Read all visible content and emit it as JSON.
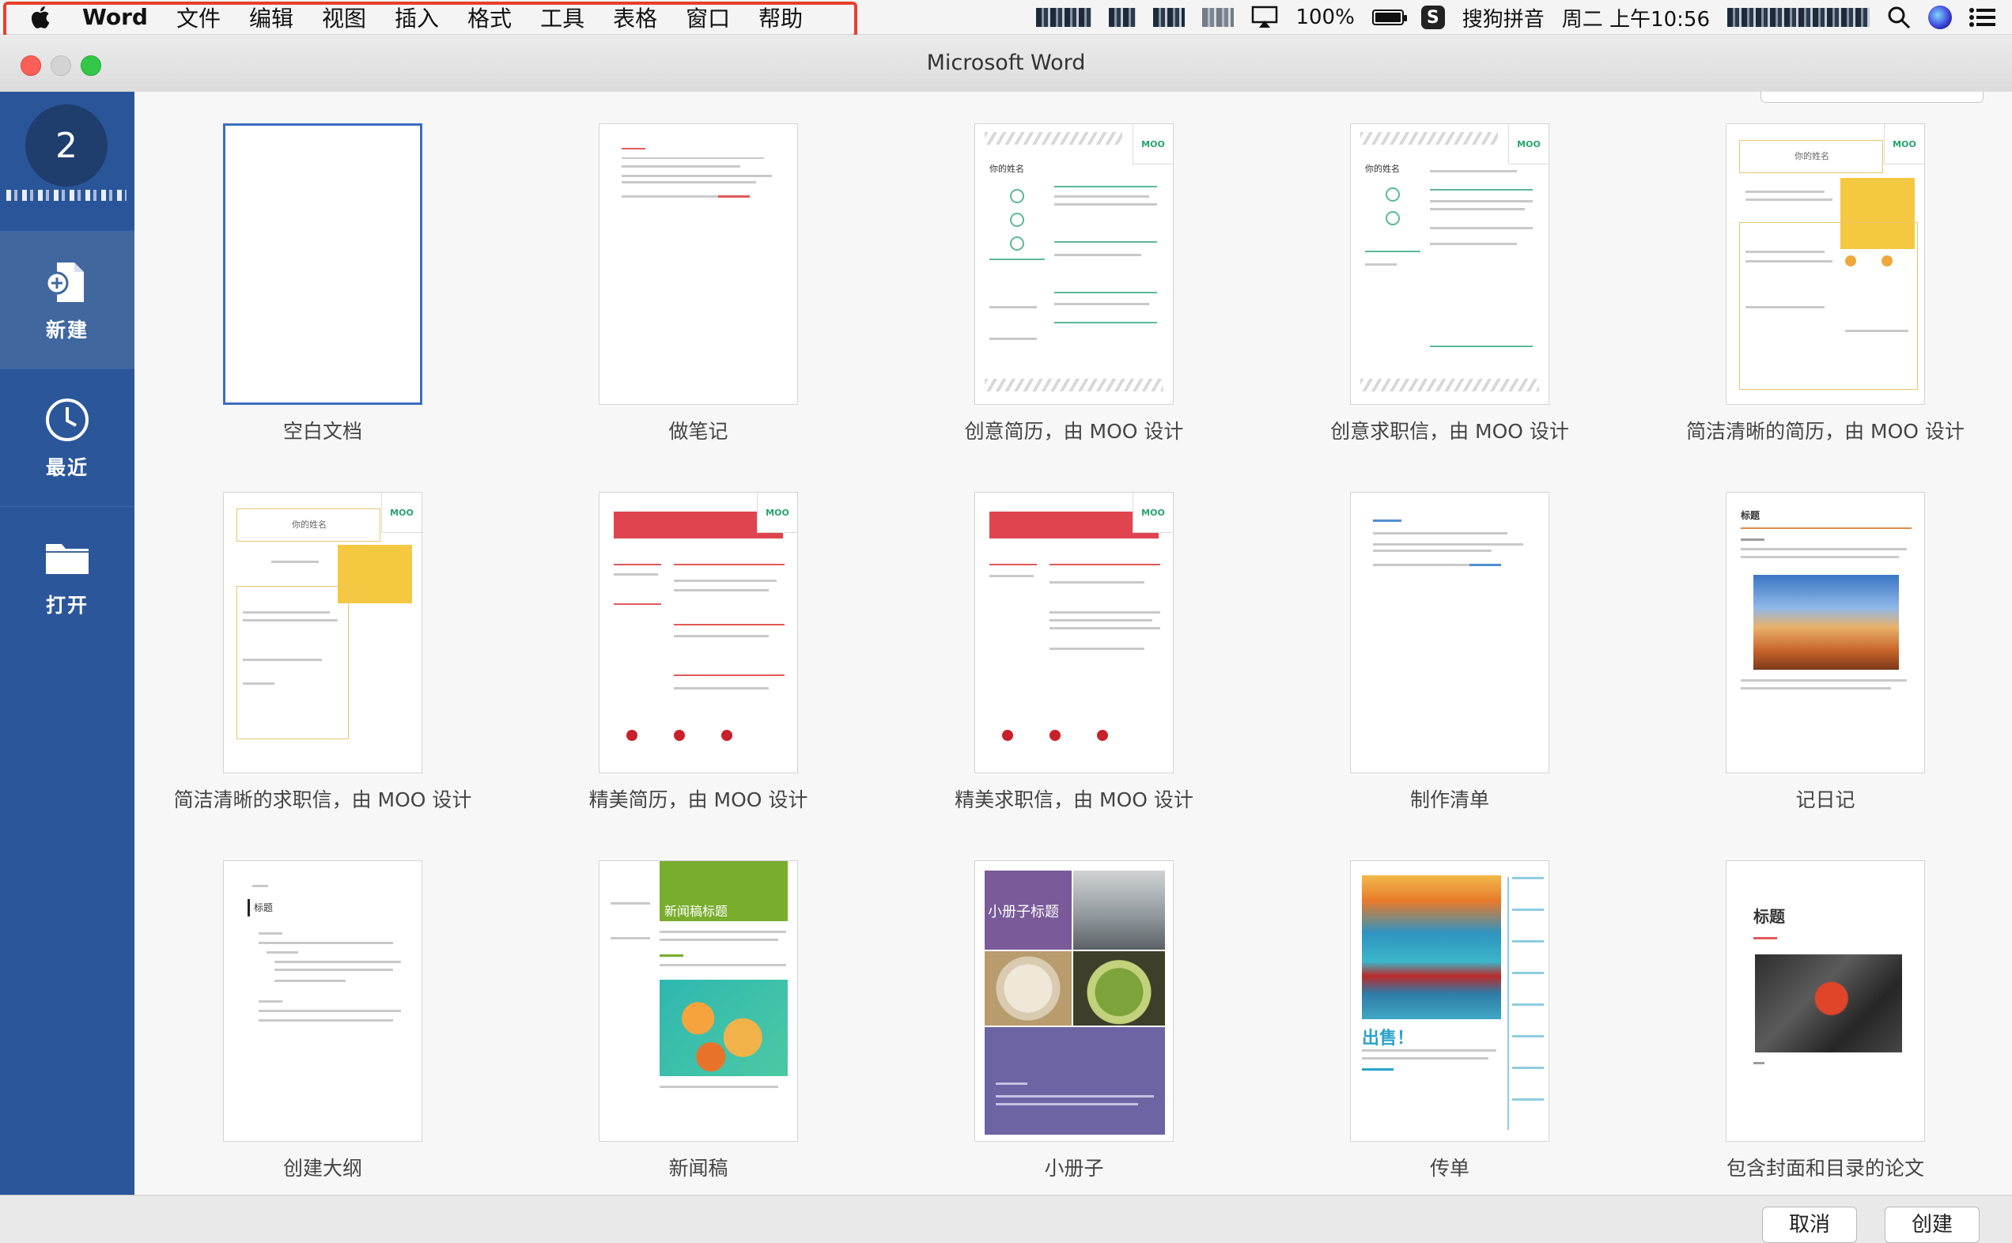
{
  "menubar": {
    "app": "Word",
    "items": [
      "文件",
      "编辑",
      "视图",
      "插入",
      "格式",
      "工具",
      "表格",
      "窗口",
      "帮助"
    ],
    "battery": "100%",
    "ime": "搜狗拼音",
    "ime_icon": "S",
    "clock": "周二 上午10:56"
  },
  "window": {
    "title": "Microsoft Word"
  },
  "sidebar": {
    "account_number": "2",
    "items": [
      {
        "label": "新建",
        "icon": "new-document-icon",
        "active": true
      },
      {
        "label": "最近",
        "icon": "clock-icon",
        "active": false
      },
      {
        "label": "打开",
        "icon": "folder-icon",
        "active": false
      }
    ]
  },
  "templates": [
    {
      "name": "空白文档"
    },
    {
      "name": "做笔记"
    },
    {
      "name": "创意简历，由 MOO 设计"
    },
    {
      "name": "创意求职信，由 MOO 设计"
    },
    {
      "name": "简洁清晰的简历，由 MOO 设计"
    },
    {
      "name": "简洁清晰的求职信，由 MOO 设计"
    },
    {
      "name": "精美简历，由 MOO 设计"
    },
    {
      "name": "精美求职信，由 MOO 设计"
    },
    {
      "name": "制作清单"
    },
    {
      "name": "记日记"
    },
    {
      "name": "创建大纲"
    },
    {
      "name": "新闻稿"
    },
    {
      "name": "小册子"
    },
    {
      "name": "传单"
    },
    {
      "name": "包含封面和目录的论文"
    }
  ],
  "thumb_text": {
    "moo": "MOO",
    "your_name": "你的姓名",
    "title": "标题",
    "news_title": "新闻稿标题",
    "booklet_title": "小册子标题",
    "sale": "出售！"
  },
  "buttons": {
    "cancel": "取消",
    "create": "创建"
  },
  "colors": {
    "sidebar": "#2b569a",
    "accent": "#3c6dbf",
    "highlight": "#e8402a"
  }
}
